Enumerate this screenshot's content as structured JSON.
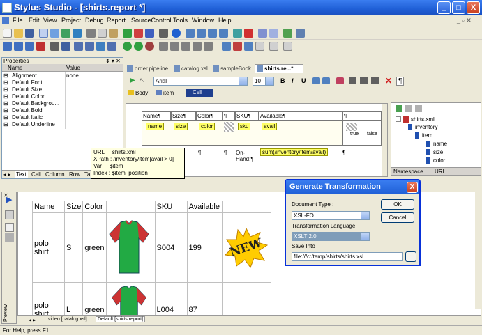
{
  "window": {
    "title": "Stylus Studio - [shirts.report *]",
    "minimize": "_",
    "maximize": "□",
    "close": "X"
  },
  "menu": [
    "File",
    "Edit",
    "View",
    "Project",
    "Debug",
    "Report",
    "SourceControl",
    "Tools",
    "Window",
    "Help"
  ],
  "properties": {
    "title": "Properties",
    "col_name": "Name",
    "col_value": "Value",
    "rows": [
      {
        "name": "Alignment",
        "value": "none"
      },
      {
        "name": "Default Font",
        "value": ""
      },
      {
        "name": "Default Size",
        "value": ""
      },
      {
        "name": "Default Color",
        "value": ""
      },
      {
        "name": "Default Backgrou...",
        "value": ""
      },
      {
        "name": "Default Bold",
        "value": ""
      },
      {
        "name": "Default Italic",
        "value": ""
      },
      {
        "name": "Default Underline",
        "value": ""
      }
    ],
    "tabs": [
      "Text",
      "Cell",
      "Column",
      "Row",
      "Table"
    ]
  },
  "doc_tabs": [
    "order.pipeline",
    "catalog.xsl",
    "sampleBook...",
    "shirts.re...*"
  ],
  "format_bar": {
    "font": "Arial",
    "size": "10",
    "bold": "B",
    "italic": "I",
    "underline": "U",
    "para": "¶"
  },
  "report_bar": {
    "body": "Body",
    "item": "item",
    "cell": "Cell"
  },
  "report": {
    "headers": [
      "Name¶",
      "Size¶",
      "Color¶",
      "¶",
      "SKU¶",
      "Available¶",
      "¶"
    ],
    "tags": [
      "name",
      "size",
      "color",
      "sku",
      "avail"
    ],
    "row2": [
      "¶",
      "¶",
      "¶",
      "On-Hand:¶"
    ],
    "sum_tag": "sum(/inventory/item/avail)",
    "true_label": "true",
    "false_label": "false",
    "para": "¶"
  },
  "tooltip": {
    "lines": [
      "URL   : shirts.xml",
      "XPath : /inventory/item[avail > 0]",
      "Var   : $item",
      "Index : $item_position"
    ]
  },
  "tree": {
    "root": "shirts.xml",
    "items": [
      {
        "label": "inventory",
        "indent": 1
      },
      {
        "label": "item",
        "indent": 2
      },
      {
        "label": "name",
        "indent": 3
      },
      {
        "label": "size",
        "indent": 3
      },
      {
        "label": "color",
        "indent": 3
      }
    ],
    "col_namespace": "Namespace",
    "col_uri": "URI"
  },
  "preview": {
    "headers": [
      "Name",
      "Size",
      "Color",
      "",
      "SKU",
      "Available",
      ""
    ],
    "rows": [
      {
        "name": "polo shirt",
        "size": "S",
        "color": "green",
        "sku": "S004",
        "available": "199"
      },
      {
        "name": "polo shirt",
        "size": "L",
        "color": "green",
        "sku": "L004",
        "available": "87"
      }
    ],
    "badge": "NEW",
    "tabs": [
      "video [catalog.xsl]",
      "Default [shirts.report]"
    ],
    "side_label": "Preview"
  },
  "dialog": {
    "title": "Generate Transformation",
    "doc_type_label": "Document Type :",
    "doc_type_value": "XSL-FO",
    "lang_label": "Transformation Language",
    "lang_value": "XSLT 2.0",
    "save_label": "Save Into",
    "save_value": "file:///c:/temp/shirts/shirts.xsl",
    "ok": "OK",
    "cancel": "Cancel",
    "browse": "...",
    "close": "X"
  },
  "status": {
    "text": "For Help, press F1"
  },
  "colors": {
    "title_blue": "#2a63d6",
    "dialog_title": "#2f6ad8",
    "tag_yellow": "#ffff66",
    "shirt_green": "#22aa44",
    "shirt_red": "#cc3333",
    "badge_yellow": "#ffcc00"
  }
}
